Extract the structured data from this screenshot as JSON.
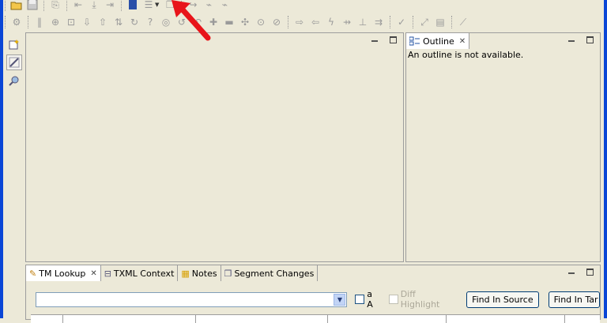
{
  "outline": {
    "tab_label": "Outline",
    "message": "An outline is not available."
  },
  "bottom_tabs": [
    {
      "label": "TM Lookup",
      "active": true
    },
    {
      "label": "TXML Context",
      "active": false
    },
    {
      "label": "Notes",
      "active": false
    },
    {
      "label": "Segment Changes",
      "active": false
    }
  ],
  "search": {
    "value": "",
    "match_case_label": "a A",
    "diff_highlight_label": "Diff Highlight",
    "find_source_label": "Find In Source",
    "find_target_label": "Find In Tar"
  },
  "colors": {
    "frame": "#0a46d6",
    "background": "#ece9d8",
    "arrow": "#e8141a"
  }
}
